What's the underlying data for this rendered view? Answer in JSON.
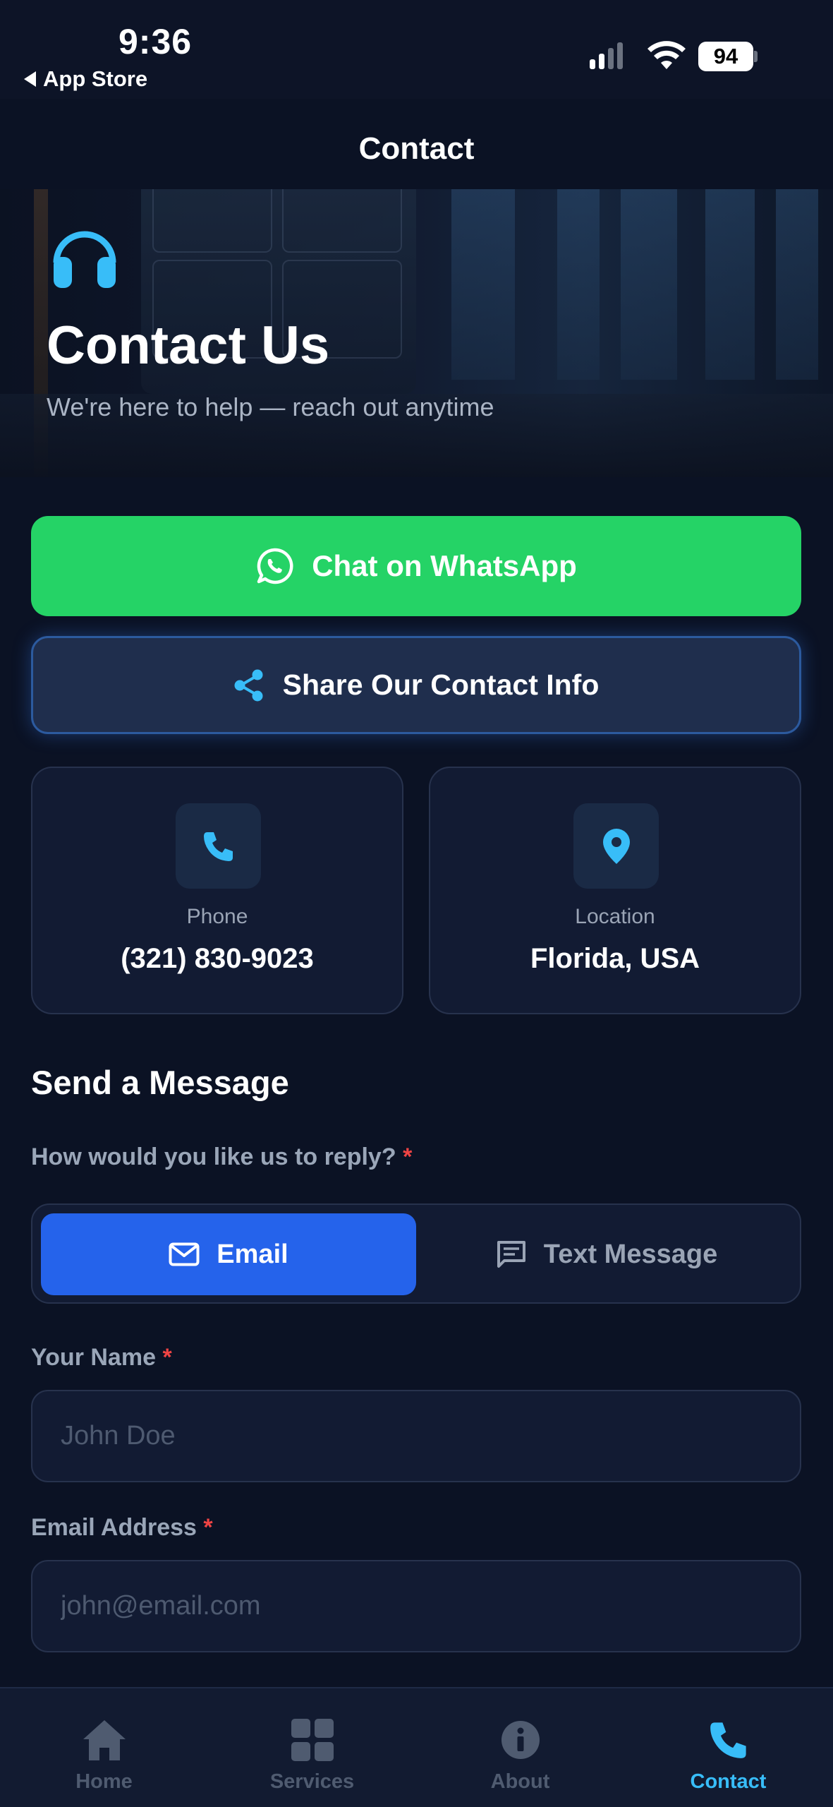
{
  "status_bar": {
    "time": "9:36",
    "back_app": "App Store",
    "battery": "94"
  },
  "nav": {
    "title": "Contact"
  },
  "hero": {
    "title": "Contact Us",
    "subtitle": "We're here to help — reach out anytime"
  },
  "actions": {
    "whatsapp_label": "Chat on WhatsApp",
    "share_label": "Share Our Contact Info"
  },
  "info_cards": {
    "phone": {
      "label": "Phone",
      "value": "(321) 830-9023"
    },
    "location": {
      "label": "Location",
      "value": "Florida, USA"
    }
  },
  "form": {
    "title": "Send a Message",
    "reply_label": "How would you like us to reply?",
    "required_mark": "*",
    "reply_options": [
      {
        "label": "Email",
        "selected": true
      },
      {
        "label": "Text Message",
        "selected": false
      }
    ],
    "name": {
      "label": "Your Name",
      "placeholder": "John Doe",
      "value": ""
    },
    "email": {
      "label": "Email Address",
      "placeholder": "john@email.com",
      "value": ""
    }
  },
  "tabbar": {
    "items": [
      {
        "label": "Home",
        "icon": "home-icon",
        "active": false
      },
      {
        "label": "Services",
        "icon": "grid-icon",
        "active": false
      },
      {
        "label": "About",
        "icon": "info-icon",
        "active": false
      },
      {
        "label": "Contact",
        "icon": "phone-icon",
        "active": true
      }
    ]
  },
  "colors": {
    "background": "#0b1224",
    "whatsapp": "#25d366",
    "primary": "#2563eb",
    "accent": "#38bdf8",
    "required": "#ef4444"
  }
}
